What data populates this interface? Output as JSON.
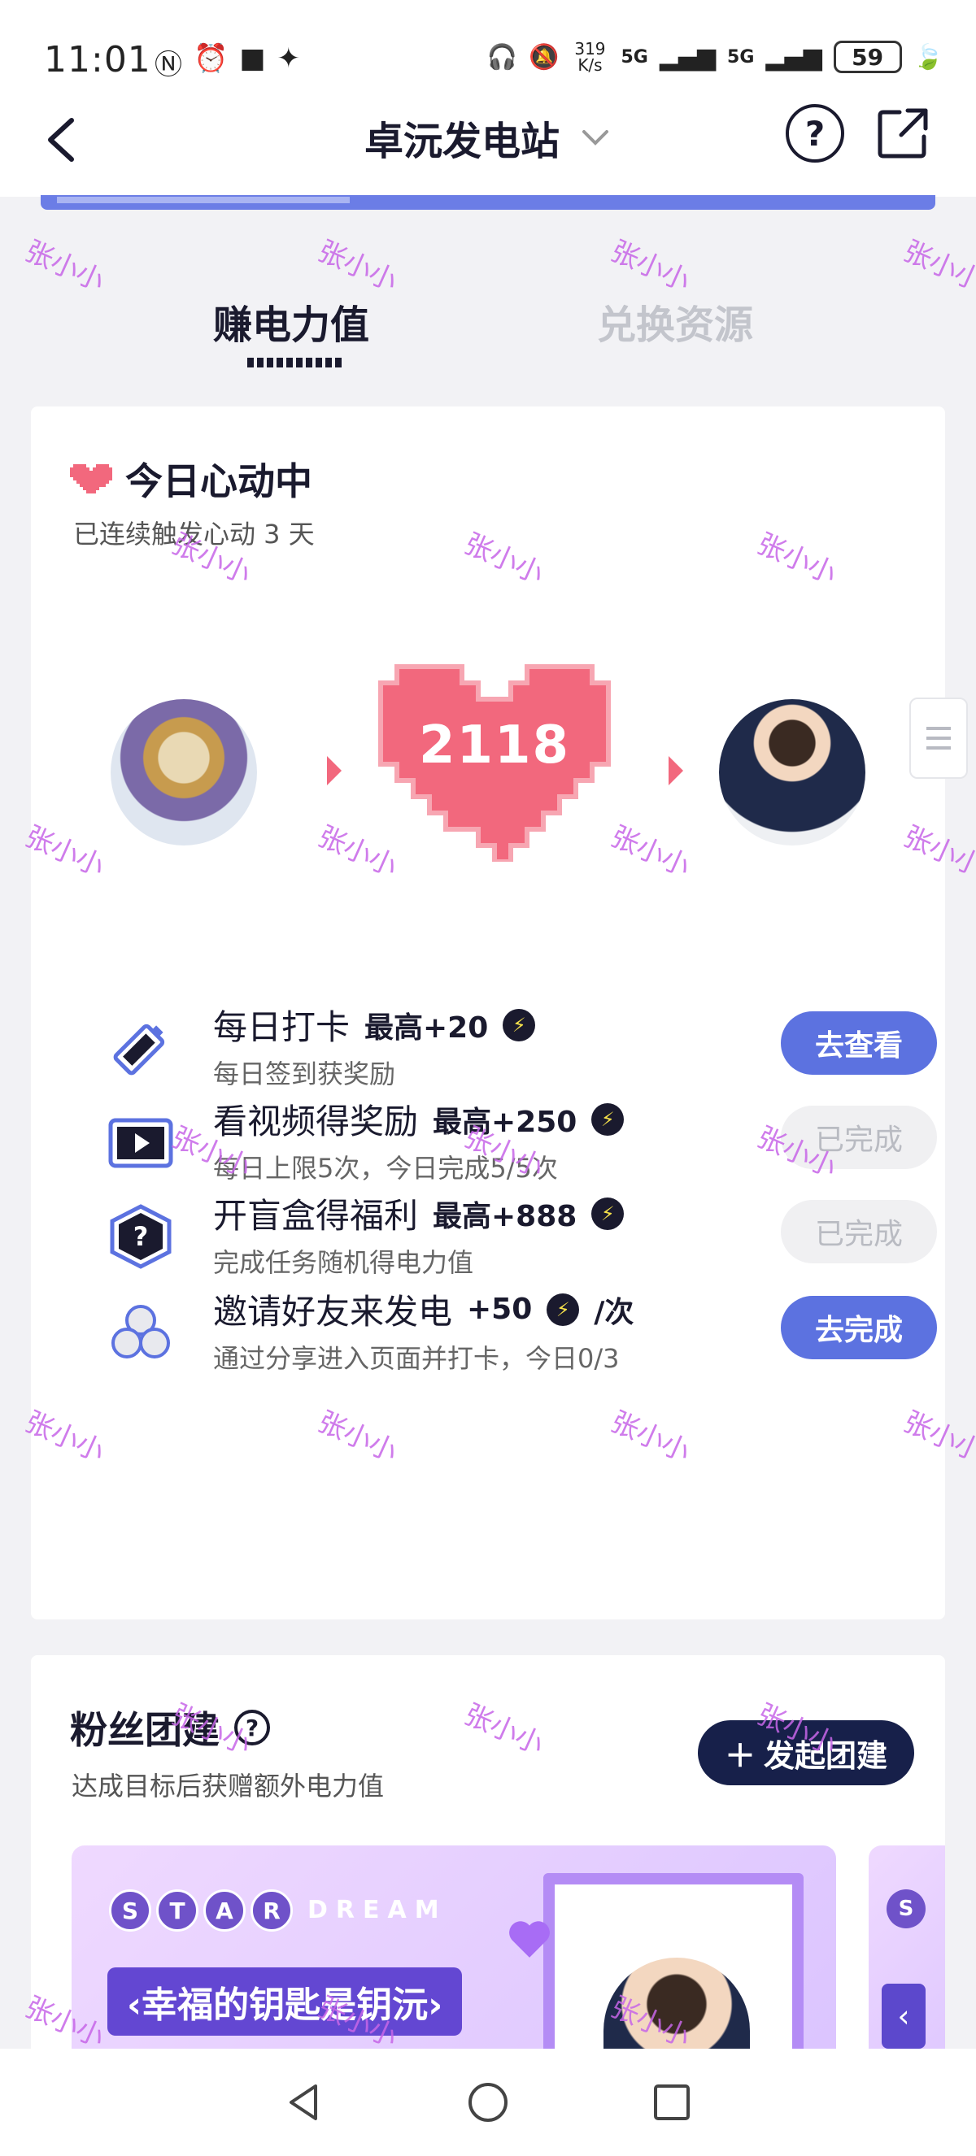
{
  "status_bar": {
    "time": "11:01",
    "speed_value": "319",
    "speed_unit": "K/s",
    "net1": "5G",
    "net2": "5G",
    "battery": "59"
  },
  "header": {
    "title": "卓沅发电站",
    "back_icon": "chevron-left-icon",
    "dropdown_icon": "chevron-down-icon",
    "help_label": "?",
    "share_icon": "share-icon"
  },
  "tabs": [
    {
      "label": "赚电力值",
      "active": true
    },
    {
      "label": "兑换资源",
      "active": false
    }
  ],
  "heart_section": {
    "title": "今日心动中",
    "subtitle": "已连续触发心动 3 天",
    "count": "2118",
    "heart_color": "#f2687d"
  },
  "tasks": [
    {
      "title": "每日打卡",
      "reward": "最高+20",
      "suffix": "",
      "desc": "每日签到获奖励",
      "button": "去查看",
      "state": "go",
      "icon": "battery-icon"
    },
    {
      "title": "看视频得奖励",
      "reward": "最高+250",
      "suffix": "",
      "desc": "每日上限5次，今日完成5/5次",
      "button": "已完成",
      "state": "done",
      "icon": "video-icon"
    },
    {
      "title": "开盲盒得福利",
      "reward": "最高+888",
      "suffix": "",
      "desc": "完成任务随机得电力值",
      "button": "已完成",
      "state": "done",
      "icon": "mystery-box-icon"
    },
    {
      "title": "邀请好友来发电",
      "reward": "+50",
      "suffix": "/次",
      "desc": "通过分享进入页面并打卡，今日0/3",
      "button": "去完成",
      "state": "go",
      "icon": "friends-icon"
    }
  ],
  "fans_section": {
    "title": "粉丝团建",
    "help_label": "?",
    "subtitle": "达成目标后获赠额外电力值",
    "start_button": "发起团建",
    "start_icon": "plus-icon",
    "banner_letters": [
      "S",
      "T",
      "A",
      "R"
    ],
    "banner_word2": "DREAM",
    "banner_slogan": "‹幸福的钥匙是钥沅›",
    "peek_letter": "S",
    "peek_nav": "‹"
  },
  "watermark": "张小小",
  "colors": {
    "accent": "#5c72e0",
    "dark": "#17204a",
    "heart": "#f2687d",
    "watermark": "#c766e8"
  }
}
